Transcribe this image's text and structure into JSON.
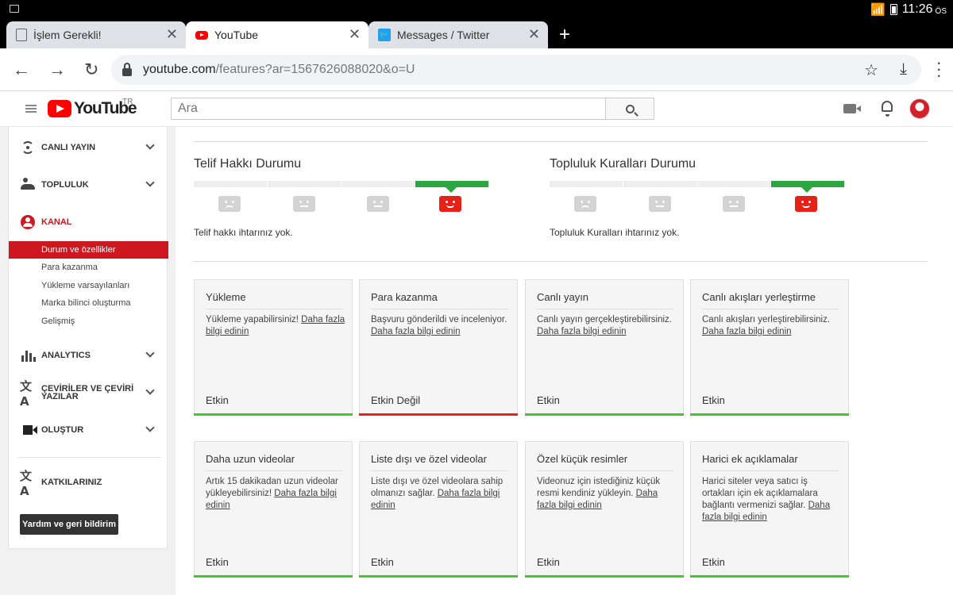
{
  "status_bar": {
    "time": "11:26",
    "ampm": "ÖS"
  },
  "tabs": [
    {
      "title": "İşlem Gerekli!",
      "active": false,
      "icon": "document-icon"
    },
    {
      "title": "YouTube",
      "active": true,
      "icon": "youtube-icon"
    },
    {
      "title": "Messages / Twitter",
      "active": false,
      "icon": "twitter-icon"
    }
  ],
  "address": {
    "host": "youtube.com",
    "path": "/features?ar=1567626088020&o=U"
  },
  "yt_header": {
    "logo_text": "YouTube",
    "region": "TR",
    "search_placeholder": "Ara"
  },
  "sidebar": {
    "live": "CANLI YAYIN",
    "community": "TOPLULUK",
    "channel": "KANAL",
    "channel_items": [
      "Durum ve özellikler",
      "Para kazanma",
      "Yükleme varsayılanları",
      "Marka bilinci oluşturma",
      "Gelişmiş"
    ],
    "analytics": "ANALYTICS",
    "translations_line1": "ÇEVİRİLER VE ÇEVİRİ",
    "translations_line2": "YAZILAR",
    "create": "OLUŞTUR",
    "contributions": "KATKILARINIZ",
    "help_button": "Yardım ve geri bildirim"
  },
  "copyright": {
    "title": "Telif Hakkı Durumu",
    "note": "Telif hakkı ihtarınız yok.",
    "active_level": 4
  },
  "community_guidelines": {
    "title": "Topluluk Kuralları Durumu",
    "note": "Topluluk Kuralları ihtarınız yok.",
    "active_level": 4
  },
  "features": [
    {
      "title": "Yükleme",
      "desc": "Yükleme yapabilirsiniz! ",
      "link": "Daha fazla bilgi edinin",
      "status": "Etkin",
      "ok": true
    },
    {
      "title": "Para kazanma",
      "desc": "Başvuru gönderildi ve inceleniyor. ",
      "link": "Daha fazla bilgi edinin",
      "status": "Etkin Değil",
      "ok": false
    },
    {
      "title": "Canlı yayın",
      "desc": "Canlı yayın gerçekleştirebilirsiniz. ",
      "link": "Daha fazla bilgi edinin",
      "status": "Etkin",
      "ok": true
    },
    {
      "title": "Canlı akışları yerleştirme",
      "desc": "Canlı akışları yerleştirebilirsiniz. ",
      "link": "Daha fazla bilgi edinin",
      "status": "Etkin",
      "ok": true
    },
    {
      "title": "Daha uzun videolar",
      "desc": "Artık 15 dakikadan uzun videolar yükleyebilirsiniz! ",
      "link": "Daha fazla bilgi edinin",
      "status": "Etkin",
      "ok": true
    },
    {
      "title": "Liste dışı ve özel videolar",
      "desc": "Liste dışı ve özel videolara sahip olmanızı sağlar. ",
      "link": "Daha fazla bilgi edinin",
      "status": "Etkin",
      "ok": true
    },
    {
      "title": "Özel küçük resimler",
      "desc": "Videonuz için istediğiniz küçük resmi kendiniz yükleyin. ",
      "link": "Daha fazla bilgi edinin",
      "status": "Etkin",
      "ok": true
    },
    {
      "title": "Harici ek açıklamalar",
      "desc": "Harici siteler veya satıcı iş ortakları için ek açıklamalara bağlantı vermenizi sağlar. ",
      "link": "Daha fazla bilgi edinin",
      "status": "Etkin",
      "ok": true
    }
  ],
  "colors": {
    "youtube_red": "#ff0000",
    "active_red": "#cc181e",
    "ok_green": "#40c82d",
    "meter_green": "#2ba640"
  }
}
